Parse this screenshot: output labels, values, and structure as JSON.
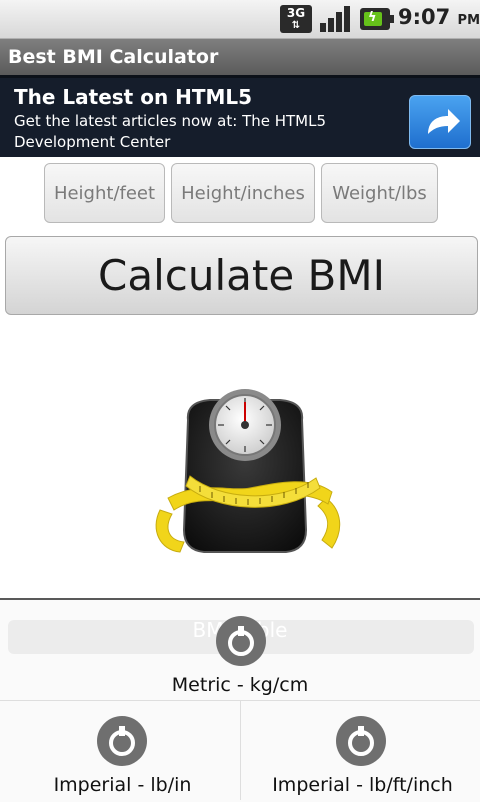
{
  "status_bar": {
    "network": "3G",
    "time": "9:07",
    "ampm": "PM"
  },
  "app": {
    "title": "Best BMI Calculator"
  },
  "ad": {
    "title": "The Latest on HTML5",
    "text": "Get the latest articles now at: The HTML5 Development Center",
    "button_icon": "share-arrow-icon"
  },
  "inputs": {
    "height_feet_placeholder": "Height/feet",
    "height_inches_placeholder": "Height/inches",
    "weight_lbs_placeholder": "Weight/lbs"
  },
  "calculate_label": "Calculate BMI",
  "image": {
    "icon": "bathroom-scale-icon"
  },
  "units_panel": {
    "heading": "BMI Table",
    "options": [
      {
        "label": "Metric - kg/cm",
        "icon": "dial-knob-icon"
      },
      {
        "label": "Imperial - lb/in",
        "icon": "dial-knob-icon"
      },
      {
        "label": "Imperial - lb/ft/inch",
        "icon": "dial-knob-icon"
      }
    ]
  },
  "colors": {
    "title_bar": "#6a6a6a",
    "ad_bg": "#151d2b",
    "ad_button": "#2f86e0",
    "tape_yellow": "#f1d51a"
  }
}
